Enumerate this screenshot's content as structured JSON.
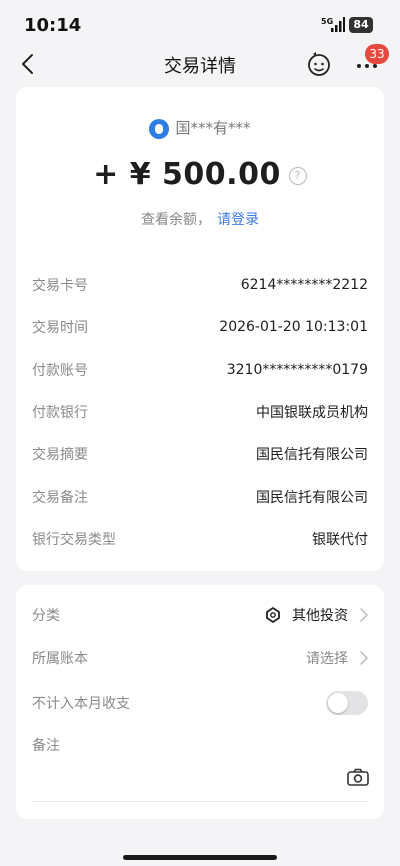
{
  "status_bar": {
    "time": "10:14",
    "network": "5G",
    "battery": "84"
  },
  "nav": {
    "title": "交易详情",
    "badge_count": "33"
  },
  "summary": {
    "payer": "国***有***",
    "amount": "+ ¥ 500.00",
    "balance_prompt": "查看余额，",
    "login_link": "请登录"
  },
  "details": [
    {
      "label": "交易卡号",
      "value": "6214********2212"
    },
    {
      "label": "交易时间",
      "value": "2026-01-20 10:13:01"
    },
    {
      "label": "付款账号",
      "value": "3210**********0179"
    },
    {
      "label": "付款银行",
      "value": "中国银联成员机构"
    },
    {
      "label": "交易摘要",
      "value": "国民信托有限公司"
    },
    {
      "label": "交易备注",
      "value": "国民信托有限公司"
    },
    {
      "label": "银行交易类型",
      "value": "银联代付"
    }
  ],
  "classification": {
    "category_label": "分类",
    "category_value": "其他投资",
    "account_label": "所属账本",
    "account_value": "请选择",
    "exclude_label": "不计入本月收支",
    "exclude_enabled": false,
    "note_label": "备注"
  },
  "colors": {
    "accent": "#3d7be0",
    "badge": "#e5493f",
    "background": "#f4f4f6"
  }
}
